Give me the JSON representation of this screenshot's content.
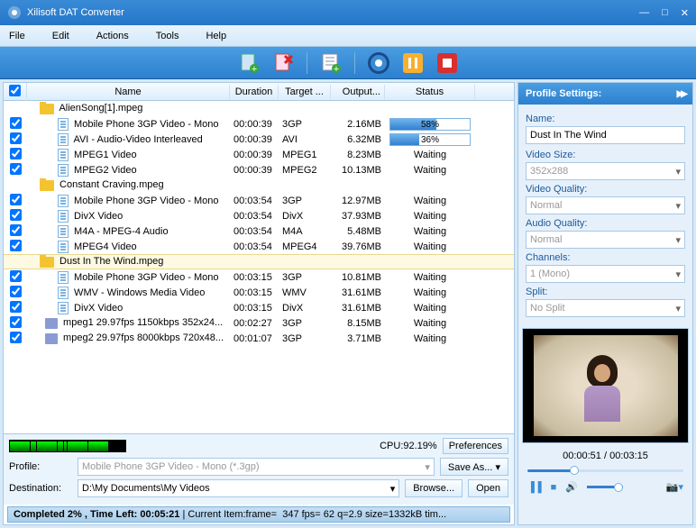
{
  "title": "Xilisoft DAT Converter",
  "menu": [
    "File",
    "Edit",
    "Actions",
    "Tools",
    "Help"
  ],
  "columns": {
    "name": "Name",
    "duration": "Duration",
    "target": "Target ...",
    "output": "Output...",
    "status": "Status"
  },
  "groups": [
    {
      "name": "AlienSong[1].mpeg",
      "items": [
        {
          "name": "Mobile Phone 3GP Video - Mono",
          "dur": "00:00:39",
          "tgt": "3GP",
          "out": "2.16MB",
          "status": "58%",
          "progress": 58
        },
        {
          "name": "AVI - Audio-Video Interleaved",
          "dur": "00:00:39",
          "tgt": "AVI",
          "out": "6.32MB",
          "status": "36%",
          "progress": 36
        },
        {
          "name": "MPEG1 Video",
          "dur": "00:00:39",
          "tgt": "MPEG1",
          "out": "8.23MB",
          "status": "Waiting"
        },
        {
          "name": "MPEG2 Video",
          "dur": "00:00:39",
          "tgt": "MPEG2",
          "out": "10.13MB",
          "status": "Waiting"
        }
      ]
    },
    {
      "name": "Constant Craving.mpeg",
      "items": [
        {
          "name": "Mobile Phone 3GP Video - Mono",
          "dur": "00:03:54",
          "tgt": "3GP",
          "out": "12.97MB",
          "status": "Waiting"
        },
        {
          "name": "DivX Video",
          "dur": "00:03:54",
          "tgt": "DivX",
          "out": "37.93MB",
          "status": "Waiting"
        },
        {
          "name": "M4A - MPEG-4 Audio",
          "dur": "00:03:54",
          "tgt": "M4A",
          "out": "5.48MB",
          "status": "Waiting"
        },
        {
          "name": "MPEG4 Video",
          "dur": "00:03:54",
          "tgt": "MPEG4",
          "out": "39.76MB",
          "status": "Waiting"
        }
      ]
    },
    {
      "name": "Dust In The Wind.mpeg",
      "selected": true,
      "items": [
        {
          "name": "Mobile Phone 3GP Video - Mono",
          "dur": "00:03:15",
          "tgt": "3GP",
          "out": "10.81MB",
          "status": "Waiting"
        },
        {
          "name": "WMV - Windows Media Video",
          "dur": "00:03:15",
          "tgt": "WMV",
          "out": "31.61MB",
          "status": "Waiting"
        },
        {
          "name": "DivX Video",
          "dur": "00:03:15",
          "tgt": "DivX",
          "out": "31.61MB",
          "status": "Waiting"
        }
      ]
    }
  ],
  "extra_rows": [
    {
      "name": "mpeg1 29.97fps 1150kbps 352x24...",
      "dur": "00:02:27",
      "tgt": "3GP",
      "out": "8.15MB",
      "status": "Waiting"
    },
    {
      "name": "mpeg2 29.97fps 8000kbps 720x48...",
      "dur": "00:01:07",
      "tgt": "3GP",
      "out": "3.71MB",
      "status": "Waiting"
    }
  ],
  "cpu": "CPU:92.19%",
  "prefs_btn": "Preferences",
  "profile_label": "Profile:",
  "profile_value": "Mobile Phone 3GP Video - Mono (*.3gp)",
  "saveas_btn": "Save As...",
  "dest_label": "Destination:",
  "dest_value": "D:\\My Documents\\My Videos",
  "browse_btn": "Browse...",
  "open_btn": "Open",
  "status_text": "Completed 2% , Time Left: 00:05:21 | Current Item:frame=  347 fps= 62 q=2.9 size=1332kB tim...",
  "side": {
    "title": "Profile Settings:",
    "name_lbl": "Name:",
    "name_val": "Dust In The Wind",
    "vsize_lbl": "Video Size:",
    "vsize_val": "352x288",
    "vqual_lbl": "Video Quality:",
    "vqual_val": "Normal",
    "aqual_lbl": "Audio Quality:",
    "aqual_val": "Normal",
    "chan_lbl": "Channels:",
    "chan_val": "1 (Mono)",
    "split_lbl": "Split:",
    "split_val": "No Split"
  },
  "playtime": "00:00:51 / 00:03:15"
}
